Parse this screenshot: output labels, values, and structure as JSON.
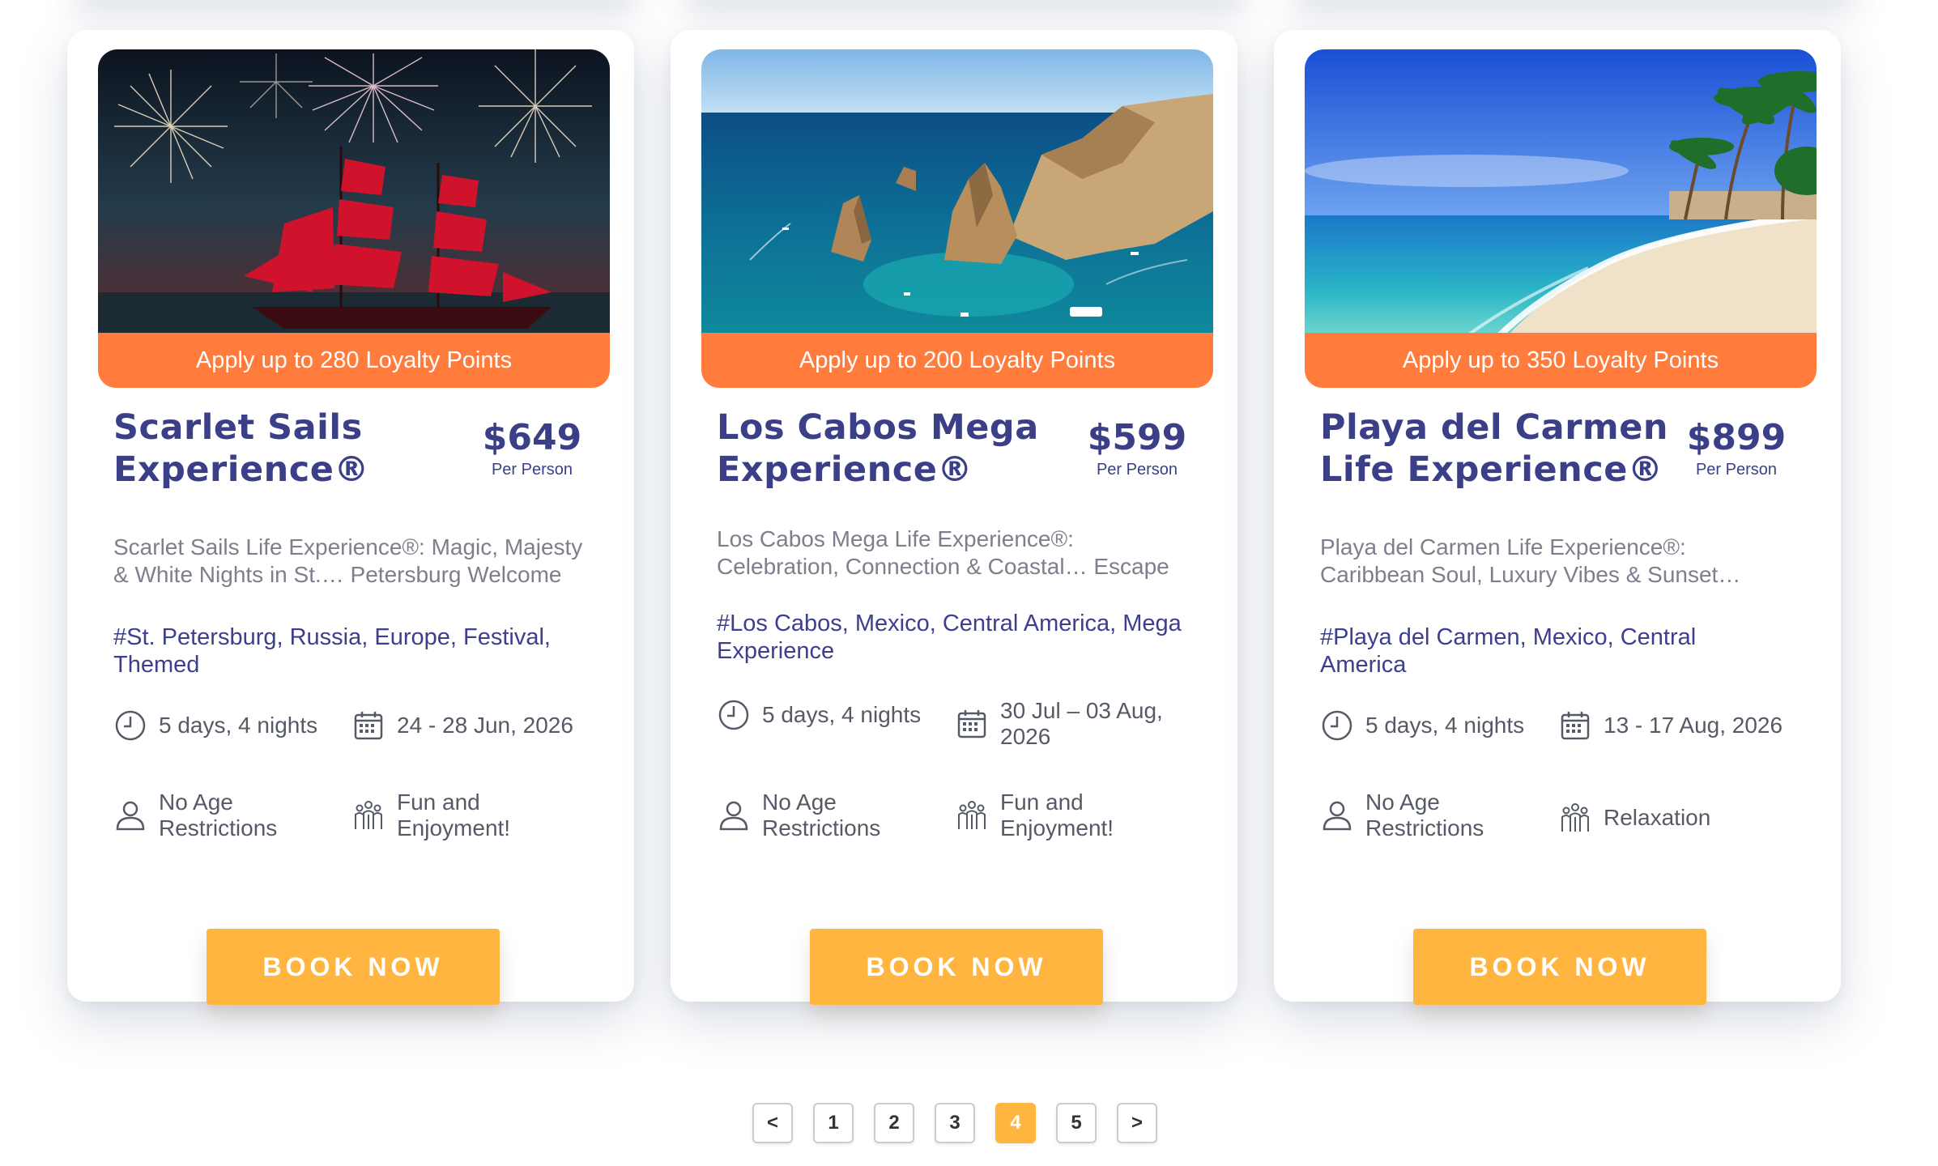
{
  "cards": [
    {
      "loyalty": "Apply up to 280 Loyalty Points",
      "title": "Scarlet Sails Experience®",
      "price": "$649",
      "per_person": "Per Person",
      "description": "Scarlet Sails Life Experience®: Magic, Majesty & White Nights in St.… Petersburg Welcome to",
      "tags": "#St. Petersburg, Russia, Europe, Festival, Themed",
      "duration": "5 days, 4 nights",
      "dates": "24 - 28 Jun, 2026",
      "age": "No Age Restrictions",
      "theme": "Fun and Enjoyment!",
      "cta": "BOOK NOW"
    },
    {
      "loyalty": "Apply up to 200 Loyalty Points",
      "title": "Los Cabos Mega Experience®",
      "price": "$599",
      "per_person": "Per Person",
      "description": "Los Cabos Mega Life Experience®: Celebration, Connection & Coastal… Escape Get ready to",
      "tags": "#Los Cabos, Mexico, Central America, Mega Experience",
      "duration": "5 days, 4 nights",
      "dates": "30 Jul – 03 Aug, 2026",
      "age": "No Age Restrictions",
      "theme": "Fun and Enjoyment!",
      "cta": "BOOK NOW"
    },
    {
      "loyalty": "Apply up to 350 Loyalty Points",
      "title": "Playa del Carmen Life Experience®",
      "price": "$899",
      "per_person": "Per Person",
      "description": "Playa del Carmen Life Experience®: Caribbean Soul, Luxury Vibes & Sunset… Magic Welcome",
      "tags": "#Playa del Carmen, Mexico, Central America",
      "duration": "5 days, 4 nights",
      "dates": "13 - 17 Aug, 2026",
      "age": "No Age Restrictions",
      "theme": "Relaxation",
      "cta": "BOOK NOW"
    }
  ],
  "pagination": {
    "prev": "<",
    "pages": [
      "1",
      "2",
      "3",
      "4",
      "5"
    ],
    "current": "4",
    "next": ">"
  },
  "colors": {
    "accent_orange": "#ff7c3d",
    "button_yellow": "#ffb540",
    "title_navy": "#3b3f87"
  },
  "icons": [
    "clock-icon",
    "calendar-icon",
    "person-icon",
    "people-icon"
  ]
}
